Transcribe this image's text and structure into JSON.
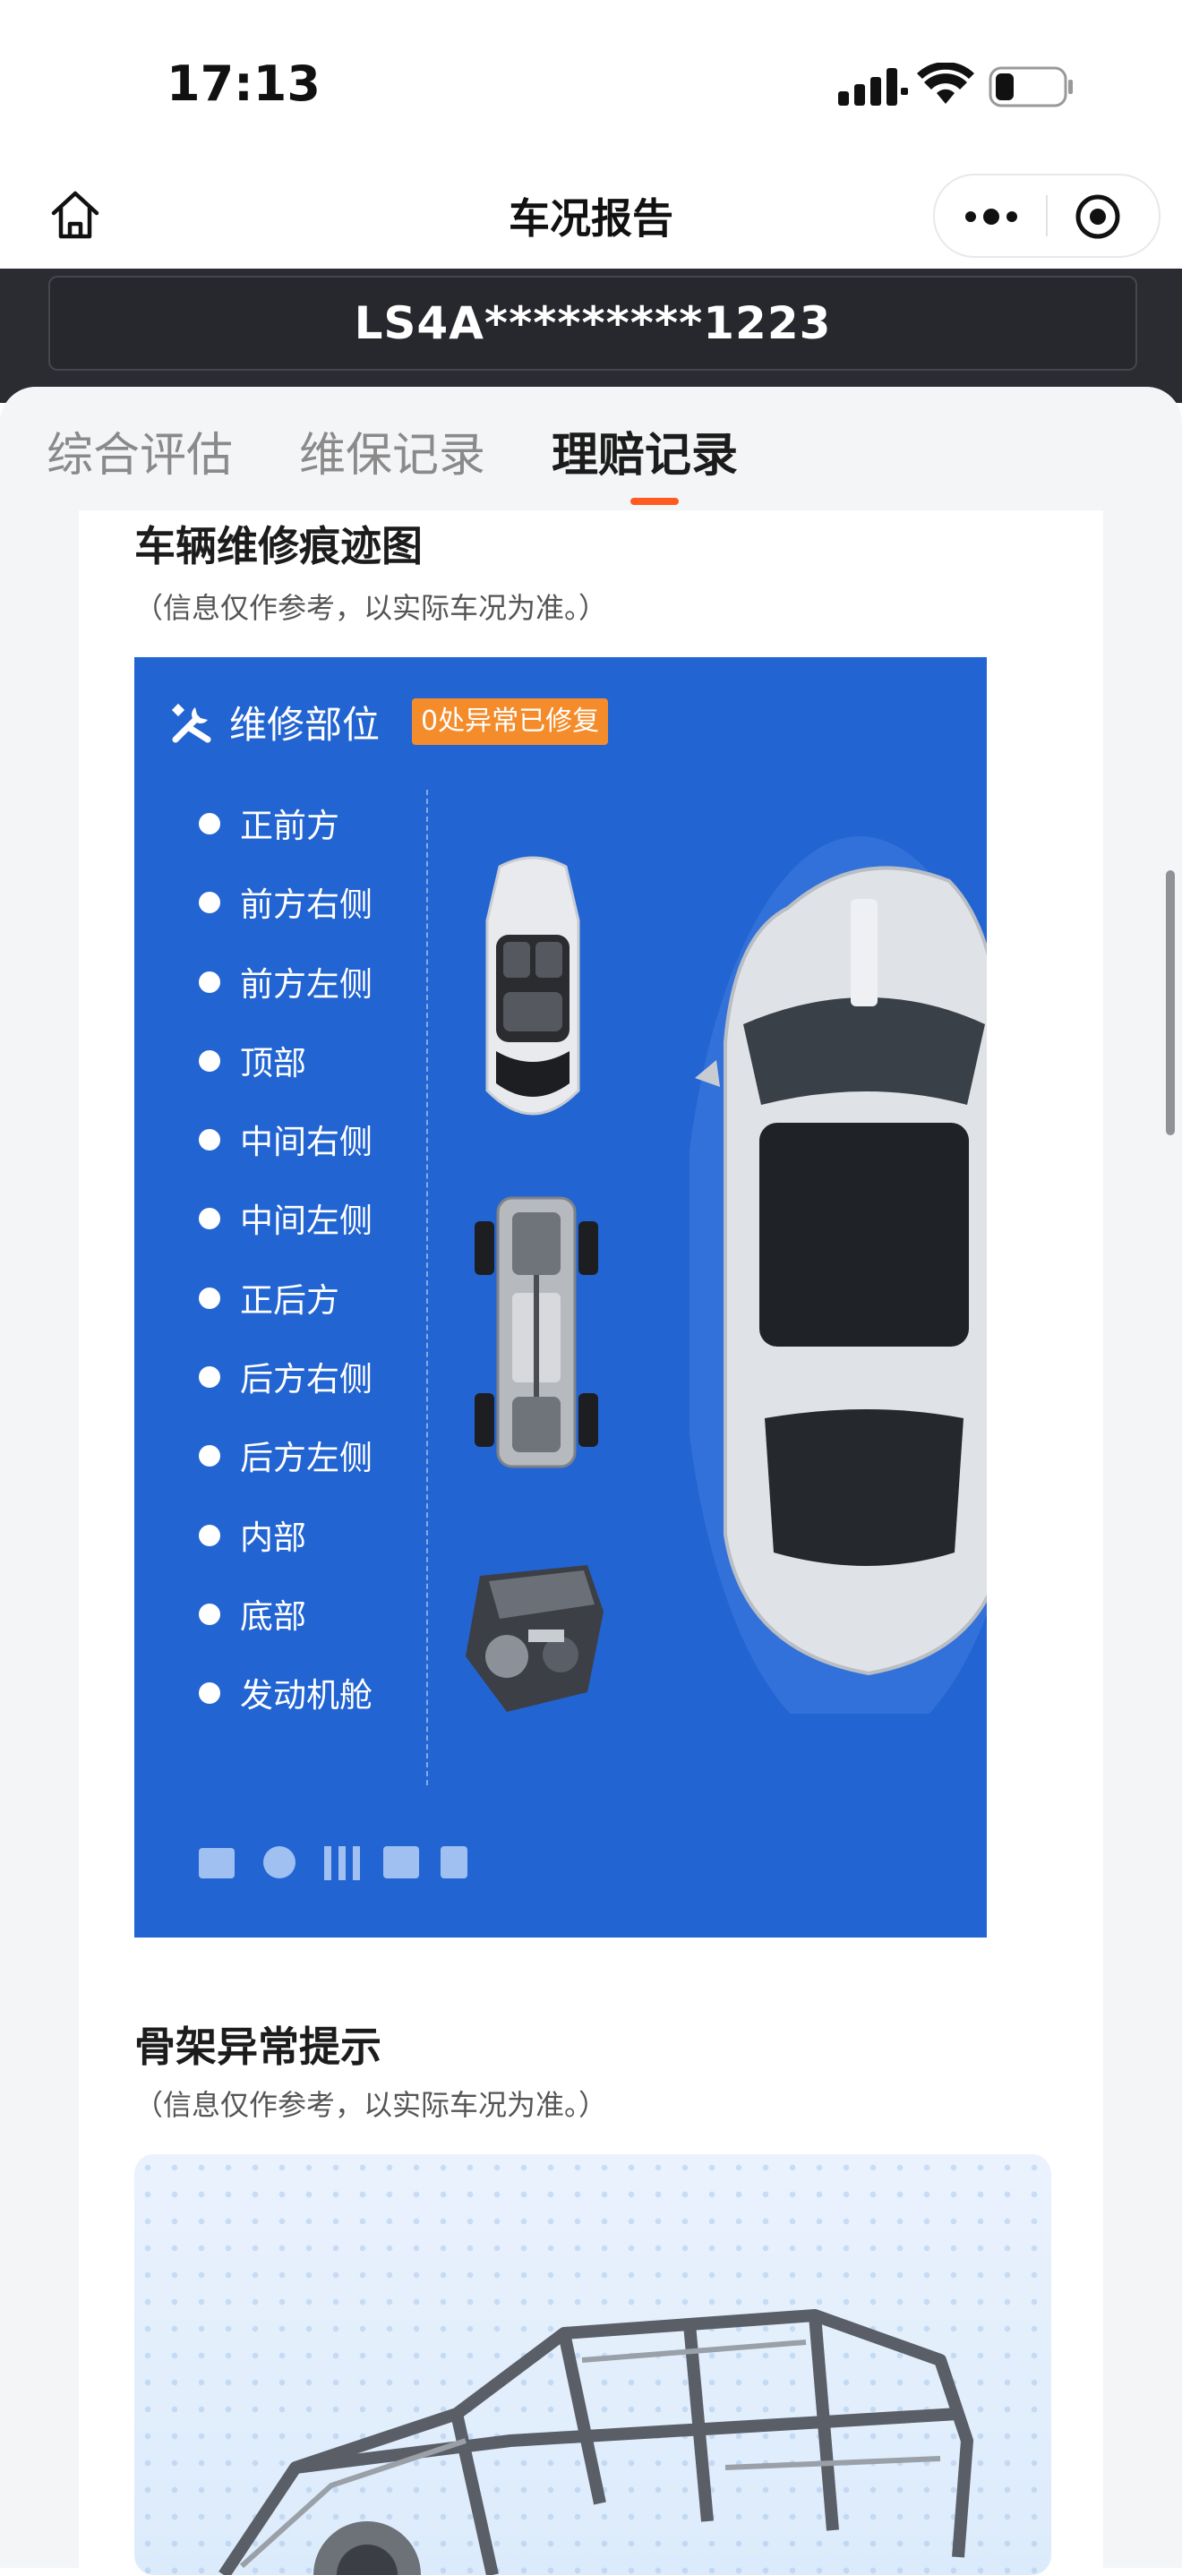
{
  "status_bar": {
    "time": "17:13"
  },
  "nav": {
    "title": "车况报告"
  },
  "vin": "LS4A*********1223",
  "tabs": [
    {
      "label": "综合评估",
      "active": false
    },
    {
      "label": "维保记录",
      "active": false
    },
    {
      "label": "理赔记录",
      "active": true
    }
  ],
  "repair_section": {
    "title": "车辆维修痕迹图",
    "note": "（信息仅作参考，以实际车况为准。）",
    "panel_title": "维修部位",
    "badge": "0处异常已修复",
    "parts": [
      "正前方",
      "前方右侧",
      "前方左侧",
      "顶部",
      "中间右侧",
      "中间左侧",
      "正后方",
      "后方右侧",
      "后方左侧",
      "内部",
      "底部",
      "发动机舱"
    ]
  },
  "frame_section": {
    "title": "骨架异常提示",
    "note": "（信息仅作参考，以实际车况为准。）"
  },
  "colors": {
    "accent": "#ff5a1f",
    "panel_blue": "#2264d1",
    "badge_orange": "#f48c2b",
    "dark_band": "#2b2c31"
  },
  "icons": [
    "home-icon",
    "more-icon",
    "target-icon",
    "wrench-icon",
    "signal-icon",
    "wifi-icon",
    "battery-icon"
  ]
}
